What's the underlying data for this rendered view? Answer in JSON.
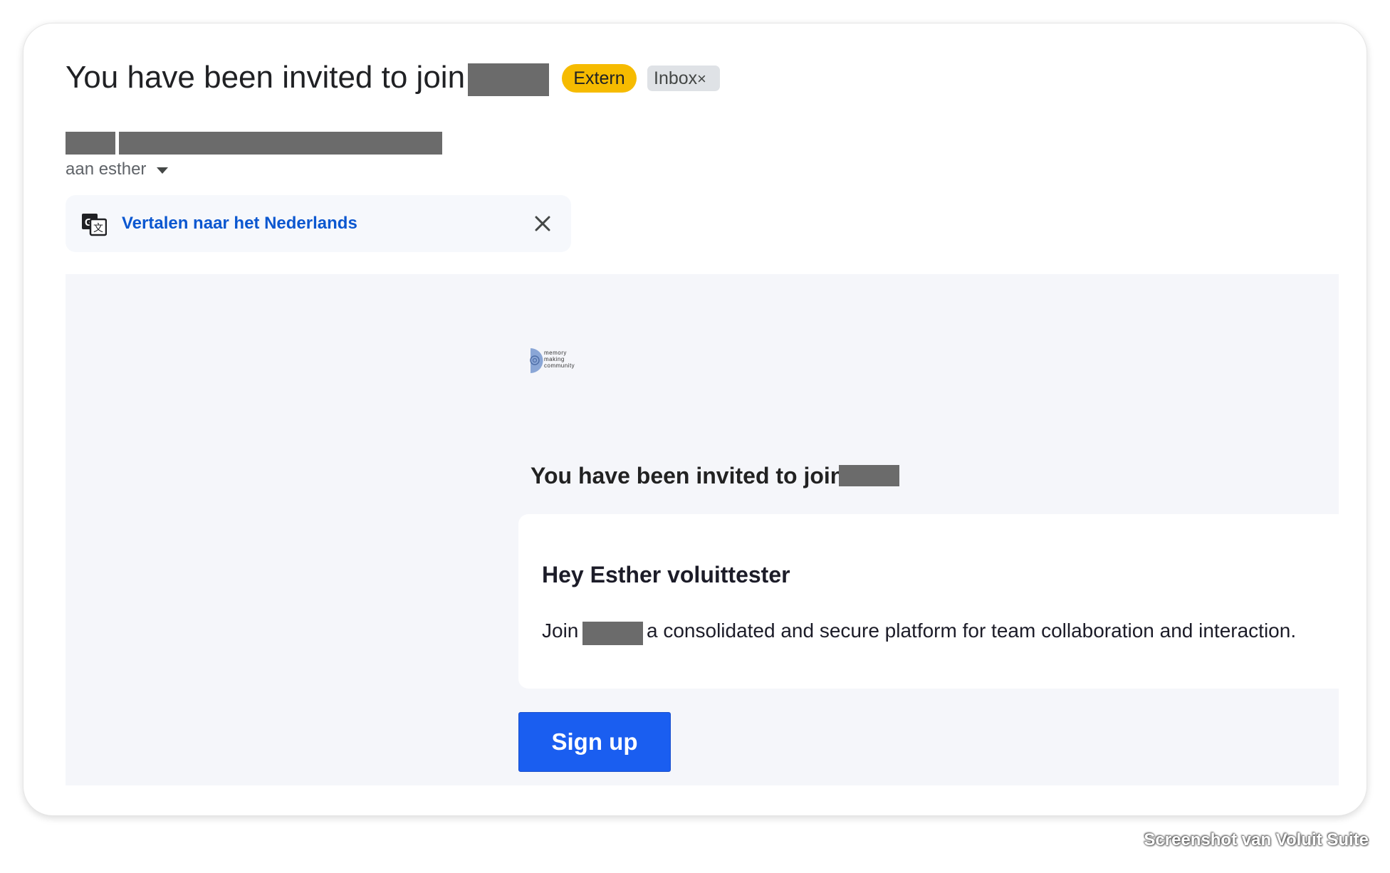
{
  "email": {
    "subject": "You have been invited to join",
    "labels": {
      "extern": "Extern",
      "inbox": "Inbox",
      "inbox_remove": "×"
    },
    "recipient_line": "aan esther"
  },
  "translate_bar": {
    "link": "Vertalen naar het Nederlands"
  },
  "message": {
    "logo_text": [
      "memory",
      "making",
      "community"
    ],
    "heading": "You have been invited to join",
    "greeting": "Hey Esther voluittester",
    "join_prefix": "Join",
    "join_suffix": "a consolidated and secure platform for team collaboration and interaction.",
    "signup_label": "Sign up"
  },
  "watermark": "Screenshot van Voluit Suite",
  "icons": [
    "translate-icon",
    "close-icon",
    "chevron-down-icon",
    "remove-label-icon"
  ],
  "colors": {
    "extern_label": "#f6bb00",
    "inbox_label": "#dfe2e6",
    "link": "#0b57d0",
    "signup_button": "#1a5ef0",
    "body_background": "#f5f6fa"
  }
}
